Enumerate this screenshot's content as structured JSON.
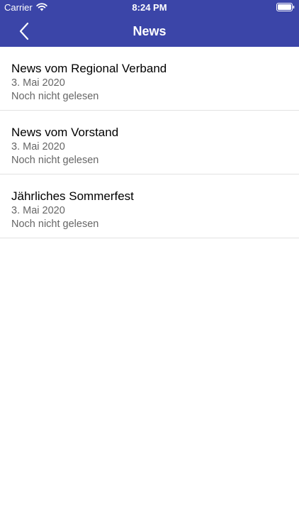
{
  "status_bar": {
    "carrier": "Carrier",
    "time": "8:24 PM"
  },
  "nav": {
    "title": "News",
    "back_icon": "chevron-left-icon"
  },
  "news": [
    {
      "title": "News vom Regional Verband",
      "date": "3. Mai 2020",
      "status": "Noch nicht gelesen"
    },
    {
      "title": "News vom Vorstand",
      "date": "3. Mai 2020",
      "status": "Noch nicht gelesen"
    },
    {
      "title": "Jährliches Sommerfest",
      "date": "3. Mai 2020",
      "status": "Noch nicht gelesen"
    }
  ],
  "colors": {
    "header": "#3b45a8",
    "secondary_text": "#666666",
    "separator": "#e2e2e2"
  }
}
